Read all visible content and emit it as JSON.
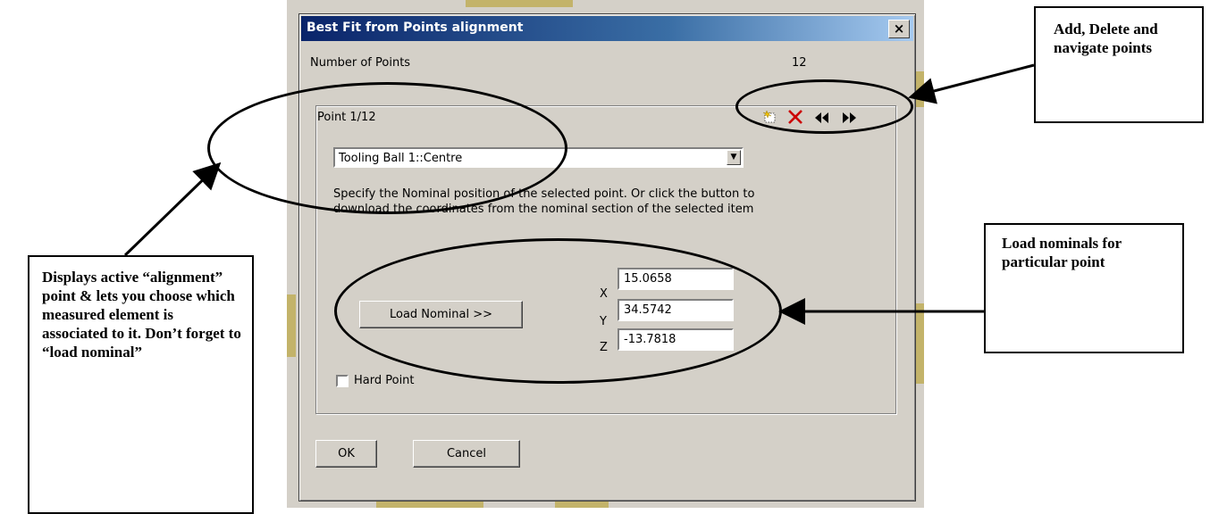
{
  "dialog": {
    "title": "Best Fit from Points alignment",
    "close_label": "×",
    "num_points_label": "Number of Points",
    "num_points_value": "12",
    "point_header": "Point 1/12",
    "toolbar": {
      "add_icon": "new-point-icon",
      "delete_icon": "delete-x-icon",
      "prev_icon": "previous-point-icon",
      "next_icon": "next-point-icon"
    },
    "element_select": "Tooling Ball 1::Centre",
    "description_line1": "Specify the Nominal position of the selected point. Or click the button to",
    "description_line2": "download the coordinates from the nominal section of the selected item",
    "load_nominal_label": "Load Nominal >>",
    "x_label": "X",
    "y_label": "Y",
    "z_label": "Z",
    "x_value": "15.0658",
    "y_value": "34.5742",
    "z_value": "-13.7818",
    "hard_point_label": "Hard Point",
    "hard_point_checked": false,
    "ok_label": "OK",
    "cancel_label": "Cancel"
  },
  "annotations": {
    "top_right": "Add, Delete and navigate points",
    "middle_right": "Load nominals for particular point",
    "left": "Displays active “alignment” point & lets you choose which measured element is associated to it. Don’t forget to “load nominal”"
  },
  "colors": {
    "title_gradient_start": "#0a246a",
    "dialog_face": "#d4d0c8",
    "delete_red": "#cc0000"
  }
}
